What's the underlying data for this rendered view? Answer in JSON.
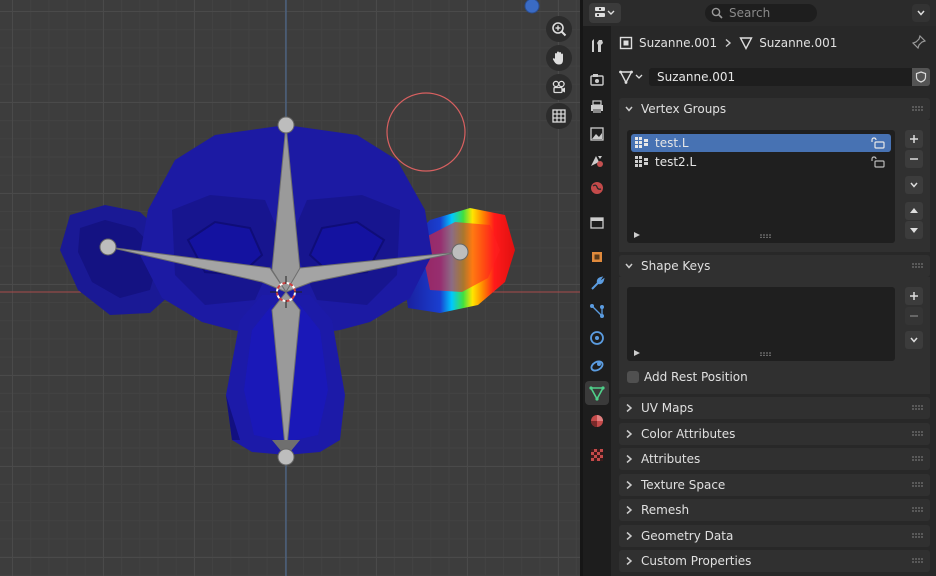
{
  "header": {
    "search_placeholder": "Search"
  },
  "breadcrumb": {
    "object_name": "Suzanne.001",
    "mesh_name": "Suzanne.001"
  },
  "mesh_datablock": {
    "name": "Suzanne.001"
  },
  "panels": {
    "vertex_groups": {
      "title": "Vertex Groups",
      "items": [
        {
          "label": "test.L",
          "selected": true
        },
        {
          "label": "test2.L",
          "selected": false
        }
      ]
    },
    "shape_keys": {
      "title": "Shape Keys",
      "add_rest_position_label": "Add Rest Position"
    },
    "collapsed": [
      {
        "label": "UV Maps"
      },
      {
        "label": "Color Attributes"
      },
      {
        "label": "Attributes"
      },
      {
        "label": "Texture Space"
      },
      {
        "label": "Remesh"
      },
      {
        "label": "Geometry Data"
      },
      {
        "label": "Custom Properties"
      }
    ]
  },
  "viewport_tools": [
    "zoom-icon",
    "pan-hand-icon",
    "camera-view-icon",
    "grid-ortho-icon"
  ],
  "colors": {
    "accent_selection": "#4772b3",
    "viewport_bg": "#3d3d3d",
    "panel_bg": "#303030",
    "mesh_blue": "#1d1ba0",
    "bone_gray": "#9a9a9a",
    "weight_red": "#ff1a1a",
    "x_axis": "#c04a4a",
    "y_axis": "#4a70a8"
  }
}
